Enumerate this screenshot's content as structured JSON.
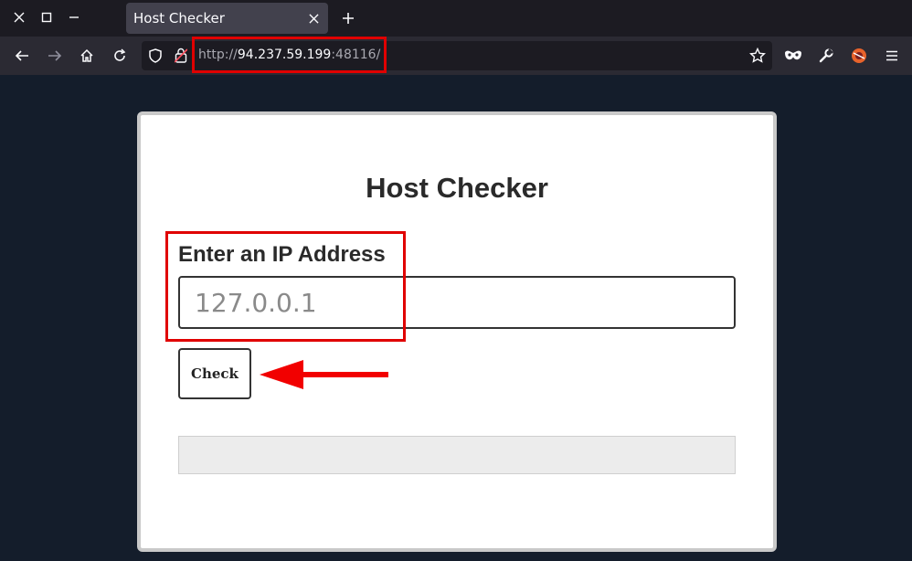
{
  "browser": {
    "tab_title": "Host Checker",
    "url": {
      "scheme": "http://",
      "host": "94.237.59.199",
      "port_path": ":48116/"
    }
  },
  "page": {
    "heading": "Host Checker",
    "ip_label": "Enter an IP Address",
    "ip_placeholder": "127.0.0.1",
    "check_button": "Check",
    "result_text": ""
  },
  "annotations": {
    "highlight_color": "#e00000"
  },
  "icons": [
    "close-icon",
    "maximize-icon",
    "minimize-icon",
    "tab-close-icon",
    "new-tab-icon",
    "back-icon",
    "forward-icon",
    "home-icon",
    "reload-icon",
    "shield-icon",
    "insecure-lock-icon",
    "bookmark-star-icon",
    "mask-icon",
    "wrench-icon",
    "extension-icon",
    "menu-icon",
    "arrow-icon"
  ]
}
